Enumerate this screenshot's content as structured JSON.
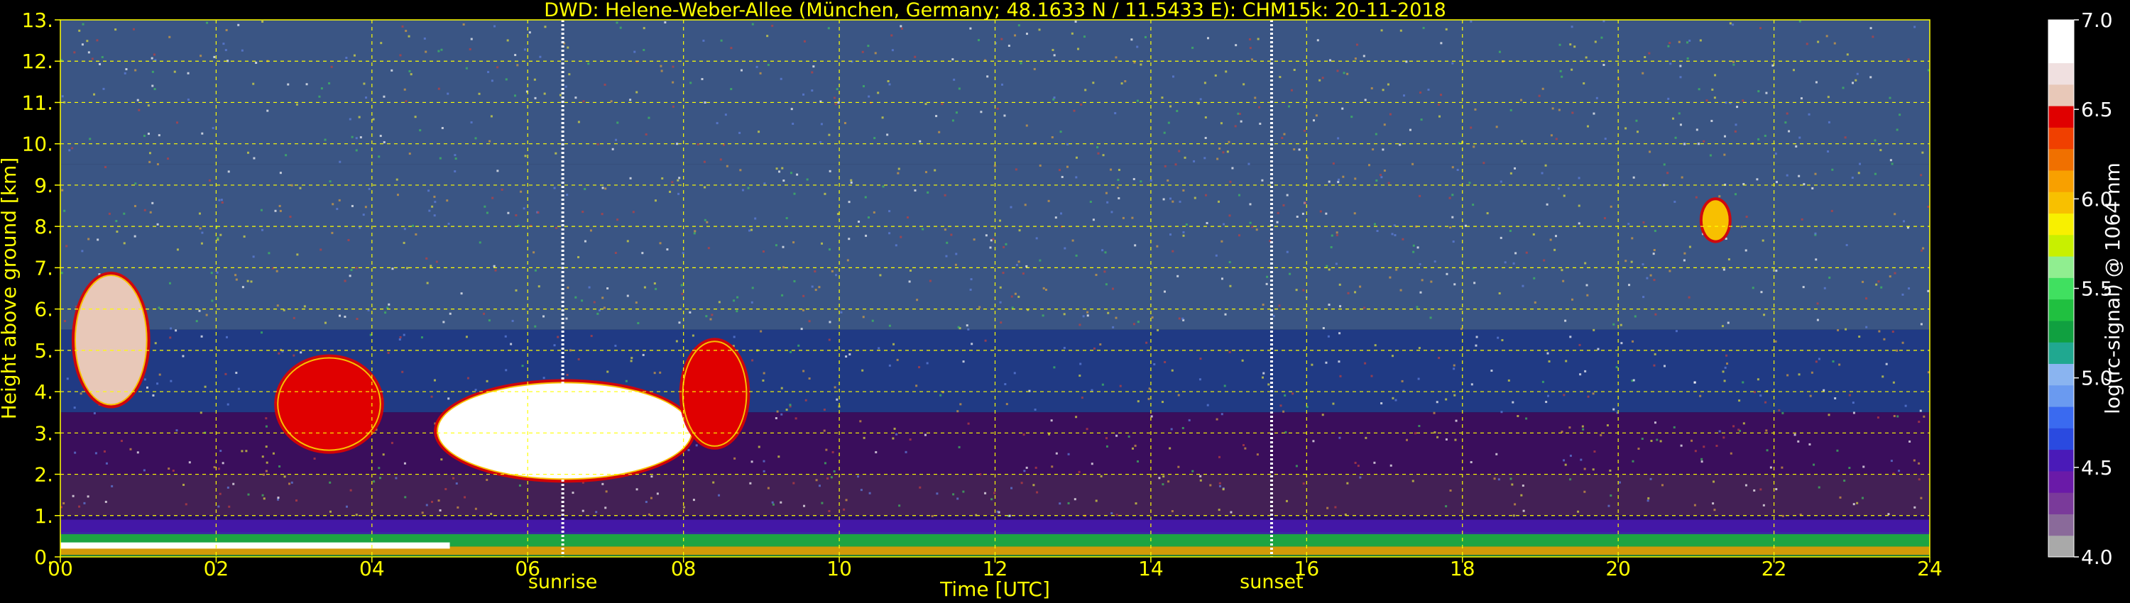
{
  "chart_data": {
    "type": "heatmap",
    "title": "DWD: Helene-Weber-Allee (München, Germany; 48.1633 N / 11.5433 E):    CHM15k: 20-11-2018",
    "xlabel": "Time [UTC]",
    "ylabel": "Height above ground [km]",
    "xlim": [
      0,
      24
    ],
    "ylim": [
      0,
      13
    ],
    "x_ticks": [
      0,
      2,
      4,
      6,
      8,
      10,
      12,
      14,
      16,
      18,
      20,
      22,
      24
    ],
    "x_tick_labels": [
      "00",
      "02",
      "04",
      "06",
      "08",
      "10",
      "12",
      "14",
      "16",
      "18",
      "20",
      "22",
      "24"
    ],
    "y_ticks": [
      0,
      1,
      2,
      3,
      4,
      5,
      6,
      7,
      8,
      9,
      10,
      11,
      12,
      13
    ],
    "y_tick_labels": [
      "0.",
      "1.",
      "2.",
      "3.",
      "4.",
      "5.",
      "6.",
      "7.",
      "8.",
      "9.",
      "10.",
      "11.",
      "12.",
      "13."
    ],
    "grid": true,
    "markers": [
      {
        "label": "sunrise",
        "x": 6.45
      },
      {
        "label": "sunset",
        "x": 15.55
      }
    ],
    "colorbar": {
      "label": "log(rc-signal) @ 1064 nm",
      "range": [
        4.0,
        7.0
      ],
      "ticks": [
        4.0,
        4.5,
        5.0,
        5.5,
        6.0,
        6.5,
        7.0
      ],
      "tick_labels": [
        "4.0",
        "4.5",
        "5.0",
        "5.5",
        "6.0",
        "6.5",
        "7.0"
      ],
      "colors": [
        "#a9a9a9",
        "#8a6a9a",
        "#7a3a9a",
        "#6a1aa8",
        "#4a1ab8",
        "#2a4ae0",
        "#3a6af0",
        "#6a9af0",
        "#8ab4f0",
        "#20a890",
        "#10a040",
        "#20c040",
        "#40e060",
        "#90ee90",
        "#c8f000",
        "#f8f000",
        "#f8c000",
        "#f8a000",
        "#f07000",
        "#f04000",
        "#e00000",
        "#e8c8b8",
        "#f0e0e0",
        "#ffffff",
        "#ffffff"
      ]
    },
    "features": [
      {
        "name": "cloud",
        "t0": 0.2,
        "t1": 1.1,
        "h0": 3.7,
        "h1": 6.8,
        "level": 6.6
      },
      {
        "name": "cloud",
        "t0": 2.8,
        "t1": 4.1,
        "h0": 2.6,
        "h1": 4.8,
        "level": 6.4
      },
      {
        "name": "cloud",
        "t0": 4.85,
        "t1": 8.1,
        "h0": 1.9,
        "h1": 4.2,
        "level": 7.0
      },
      {
        "name": "cloud",
        "t0": 8.0,
        "t1": 8.8,
        "h0": 2.7,
        "h1": 5.2,
        "level": 6.5
      },
      {
        "name": "cloud",
        "t0": 21.1,
        "t1": 21.4,
        "h0": 7.7,
        "h1": 8.6,
        "level": 6.0
      },
      {
        "name": "boundary-layer",
        "t0": 0.0,
        "t1": 24.0,
        "h0": 0.0,
        "h1": 1.0,
        "level": 5.2
      }
    ]
  }
}
